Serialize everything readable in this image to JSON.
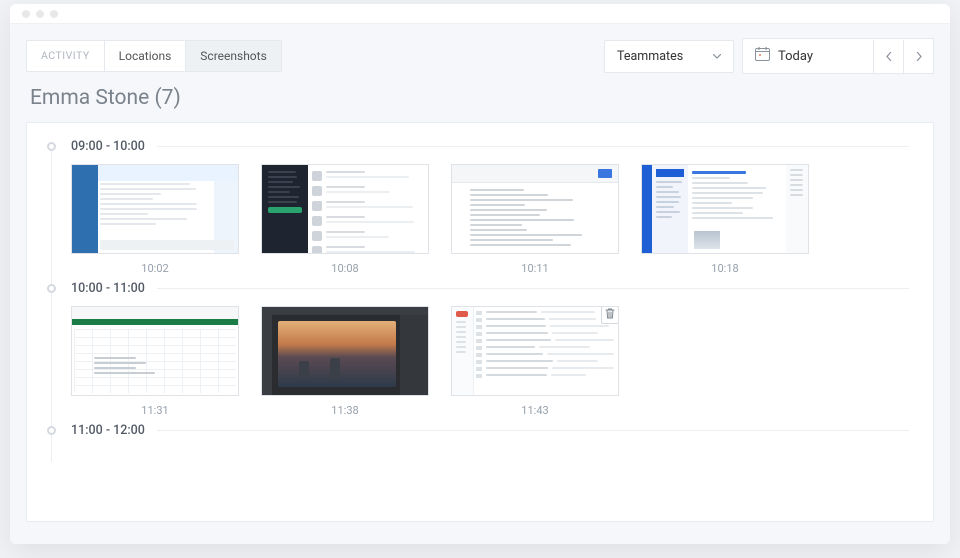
{
  "tabs": {
    "activity": "ACTIVITY",
    "locations": "Locations",
    "screenshots": "Screenshots"
  },
  "teammates_dropdown": {
    "label": "Teammates"
  },
  "date_picker": {
    "label": "Today"
  },
  "user_title": "Emma Stone (7)",
  "groups": [
    {
      "range": "09:00 - 10:00",
      "shots": [
        {
          "time": "10:02",
          "kind": "chat-light"
        },
        {
          "time": "10:08",
          "kind": "chat-dark"
        },
        {
          "time": "10:11",
          "kind": "docs"
        },
        {
          "time": "10:18",
          "kind": "mail-blue"
        }
      ]
    },
    {
      "range": "10:00 - 11:00",
      "shots": [
        {
          "time": "11:31",
          "kind": "spreadsheet"
        },
        {
          "time": "11:38",
          "kind": "photo-editor"
        },
        {
          "time": "11:43",
          "kind": "mail-list",
          "deletable": true
        }
      ]
    },
    {
      "range": "11:00 - 12:00",
      "shots": []
    }
  ]
}
